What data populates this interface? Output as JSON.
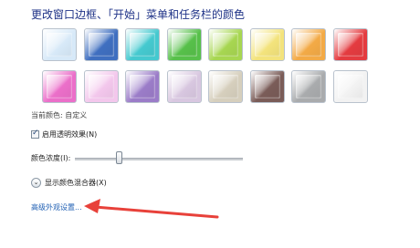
{
  "title": "更改窗口边框、「开始」菜单和任务栏的颜色",
  "swatches": [
    {
      "name": "sky",
      "color": "#d7e9f8"
    },
    {
      "name": "twilight",
      "color": "#3f6fc0"
    },
    {
      "name": "sea",
      "color": "#45c9cf"
    },
    {
      "name": "leaf",
      "color": "#57c04a"
    },
    {
      "name": "lime",
      "color": "#a7d651"
    },
    {
      "name": "lemon",
      "color": "#f3e37c"
    },
    {
      "name": "pumpkin",
      "color": "#f3aa46"
    },
    {
      "name": "ruby",
      "color": "#e43b40"
    },
    {
      "name": "fuchsia",
      "color": "#eb6fc9"
    },
    {
      "name": "blush",
      "color": "#f3c7ec"
    },
    {
      "name": "violet",
      "color": "#9b7cc8"
    },
    {
      "name": "lavender",
      "color": "#d8c7e0"
    },
    {
      "name": "taupe",
      "color": "#d6cfbd"
    },
    {
      "name": "chocolate",
      "color": "#7a5c58"
    },
    {
      "name": "slate",
      "color": "#a9abad"
    },
    {
      "name": "frost",
      "color": "#f2f2f2"
    }
  ],
  "current_color_label": "当前颜色: 自定义",
  "transparency": {
    "label": "启用透明效果(N)",
    "checked": true
  },
  "intensity": {
    "label": "颜色浓度(I):",
    "value_percent": 26
  },
  "mixer": {
    "label": "显示颜色混合器(X)"
  },
  "advanced_link": "高级外观设置...",
  "annotation_arrow_color": "#e8413a"
}
